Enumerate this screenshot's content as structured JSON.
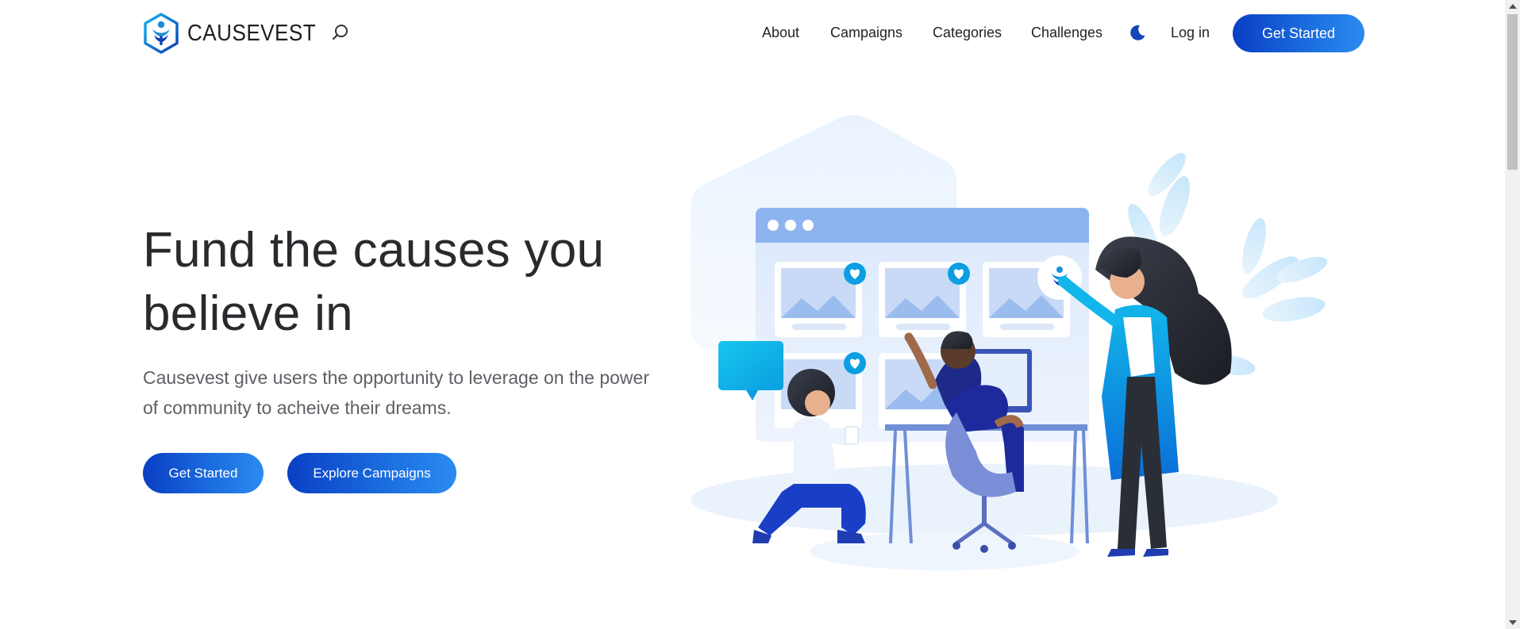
{
  "brand": {
    "name": "CAUSEVEST",
    "logo_icon": "causevest-logo-icon"
  },
  "header": {
    "search_icon": "search-icon",
    "nav": [
      {
        "label": "About"
      },
      {
        "label": "Campaigns"
      },
      {
        "label": "Categories"
      },
      {
        "label": "Challenges"
      }
    ],
    "theme_toggle_icon": "moon-icon",
    "login_label": "Log in",
    "cta_label": "Get Started"
  },
  "hero": {
    "title": "Fund the causes you believe in",
    "subtitle": "Causevest give users the opportunity to leverage on the power of community to acheive their dreams.",
    "primary_cta": "Get Started",
    "secondary_cta": "Explore Campaigns"
  },
  "colors": {
    "primary_gradient_start": "#0a3fc4",
    "primary_gradient_end": "#2b8bf0",
    "title_text": "#2a2a2e",
    "subtitle_text": "#5f5f66"
  }
}
